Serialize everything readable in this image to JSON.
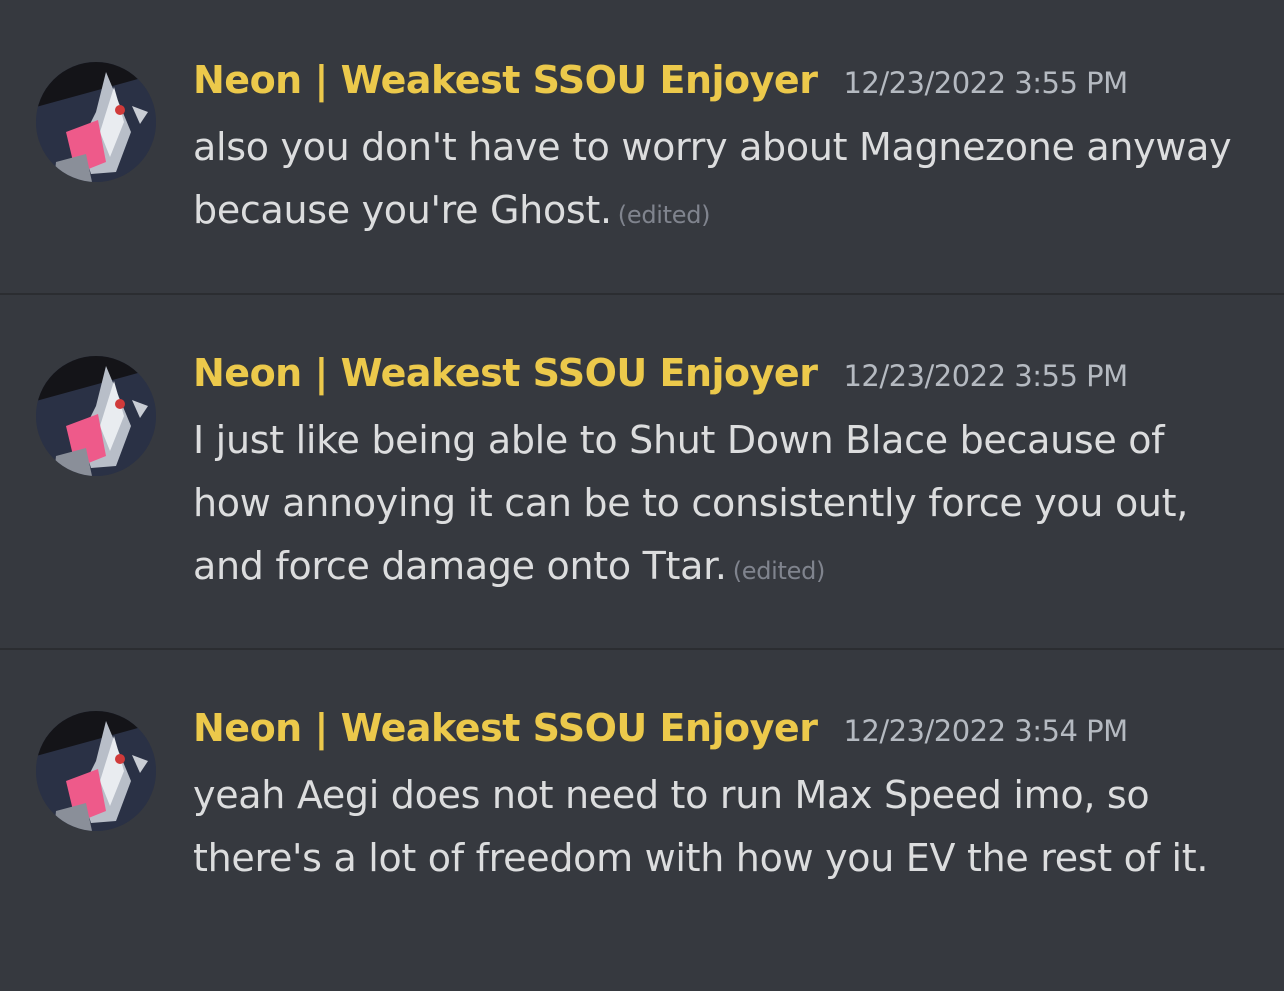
{
  "messages": [
    {
      "username": "Neon | Weakest SSOU Enjoyer",
      "timestamp": "12/23/2022 3:55 PM",
      "text": "also you don't have to worry about Magnezone anyway because you're Ghost.",
      "edited_label": "(edited)",
      "username_color": "#ecc94b"
    },
    {
      "username": "Neon | Weakest SSOU Enjoyer",
      "timestamp": "12/23/2022 3:55 PM",
      "text": "I just like being able to Shut Down Blace because of how annoying it can be to consistently force you out, and force damage onto Ttar.",
      "edited_label": "(edited)",
      "username_color": "#ecc94b"
    },
    {
      "username": "Neon | Weakest SSOU Enjoyer",
      "timestamp": "12/23/2022 3:54 PM",
      "text": "yeah Aegi does not need to run Max Speed imo, so there's a lot of freedom with how you EV the rest of it."
    }
  ],
  "theme": {
    "background": "#36393f",
    "divider": "#2b2d31",
    "text": "#dcddde",
    "timestamp": "#b5bac1",
    "edited": "#80848e"
  }
}
